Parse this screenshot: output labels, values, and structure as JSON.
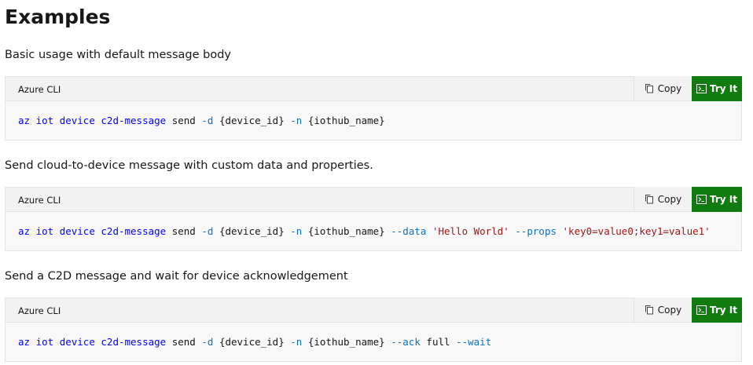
{
  "page": {
    "heading": "Examples"
  },
  "labels": {
    "lang": "Azure CLI",
    "copy": "Copy",
    "try_it": "Try It"
  },
  "colors": {
    "accent_green": "#107c10",
    "keyword_blue": "#0101fd",
    "param_blue": "#0e70c0",
    "string_red": "#a31515"
  },
  "examples": [
    {
      "description": "Basic usage with default message body",
      "code": {
        "cmd1": "az",
        "cmd2": "iot",
        "cmd3": "device",
        "cmd4": "c2d-message",
        "cmd5": "send",
        "p1": "-d",
        "v1": "{device_id}",
        "p2": "-n",
        "v2": "{iothub_name}"
      }
    },
    {
      "description": "Send cloud-to-device message with custom data and properties.",
      "code": {
        "cmd1": "az",
        "cmd2": "iot",
        "cmd3": "device",
        "cmd4": "c2d-message",
        "cmd5": "send",
        "p1": "-d",
        "v1": "{device_id}",
        "p2": "-n",
        "v2": "{iothub_name}",
        "p3": "--data",
        "s3": "'Hello World'",
        "p4": "--props",
        "s4": "'key0=value0;key1=value1'"
      }
    },
    {
      "description": "Send a C2D message and wait for device acknowledgement",
      "code": {
        "cmd1": "az",
        "cmd2": "iot",
        "cmd3": "device",
        "cmd4": "c2d-message",
        "cmd5": "send",
        "p1": "-d",
        "v1": "{device_id}",
        "p2": "-n",
        "v2": "{iothub_name}",
        "p3": "--ack",
        "v3": "full",
        "p4": "--wait"
      }
    }
  ]
}
